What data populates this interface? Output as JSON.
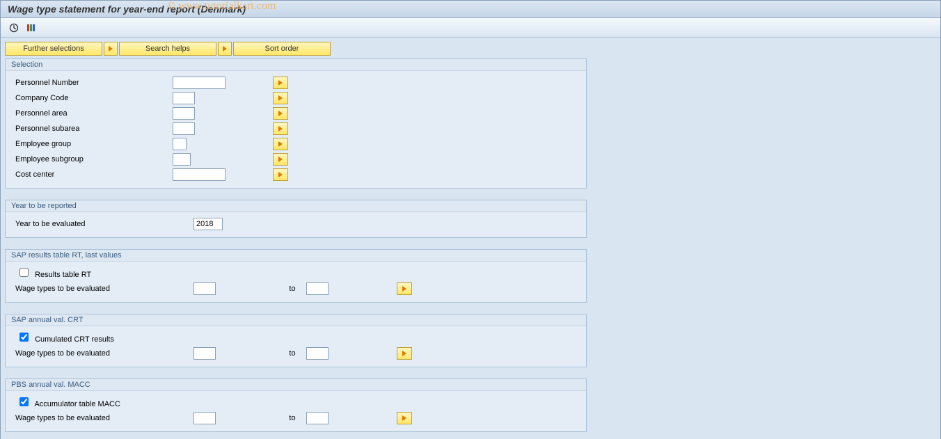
{
  "title": "Wage type statement for year-end report (Denmark)",
  "watermark": "© www.tutorialkart.com",
  "topButtons": {
    "further": "Further selections",
    "searchHelps": "Search helps",
    "sortOrder": "Sort order"
  },
  "groups": {
    "selection": {
      "title": "Selection",
      "fields": {
        "personnelNumber": "Personnel Number",
        "companyCode": "Company Code",
        "personnelArea": "Personnel area",
        "personnelSubarea": "Personnel subarea",
        "employeeGroup": "Employee group",
        "employeeSubgroup": "Employee subgroup",
        "costCenter": "Cost center"
      }
    },
    "yearReported": {
      "title": "Year to be reported",
      "label": "Year to be evaluated",
      "value": "2018"
    },
    "rt": {
      "title": "SAP results table RT, last values",
      "checkbox": "Results table RT",
      "checked": false,
      "wageLabel": "Wage types to be evaluated",
      "to": "to"
    },
    "crt": {
      "title": "SAP annual val. CRT",
      "checkbox": "Cumulated CRT results",
      "checked": true,
      "wageLabel": "Wage types to be evaluated",
      "to": "to"
    },
    "macc": {
      "title": "PBS annual val. MACC",
      "checkbox": "Accumulator table MACC",
      "checked": true,
      "wageLabel": "Wage types to be evaluated",
      "to": "to"
    }
  }
}
